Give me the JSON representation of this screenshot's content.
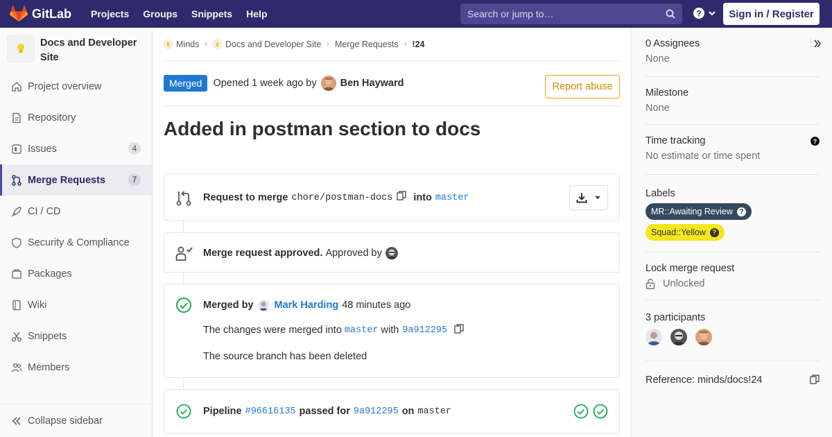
{
  "navbar": {
    "brand": "GitLab",
    "links": [
      "Projects",
      "Groups",
      "Snippets",
      "Help"
    ],
    "search_placeholder": "Search or jump to…",
    "signin_label": "Sign in / Register"
  },
  "sidebar": {
    "project_name": "Docs and Developer Site",
    "items": [
      {
        "label": "Project overview",
        "icon": "home-icon"
      },
      {
        "label": "Repository",
        "icon": "file-icon"
      },
      {
        "label": "Issues",
        "icon": "issues-icon",
        "count": "4"
      },
      {
        "label": "Merge Requests",
        "icon": "merge-request-icon",
        "count": "7",
        "active": true
      },
      {
        "label": "CI / CD",
        "icon": "rocket-icon"
      },
      {
        "label": "Security & Compliance",
        "icon": "shield-icon"
      },
      {
        "label": "Packages",
        "icon": "package-icon"
      },
      {
        "label": "Wiki",
        "icon": "book-icon"
      },
      {
        "label": "Snippets",
        "icon": "scissors-icon"
      },
      {
        "label": "Members",
        "icon": "users-icon"
      }
    ],
    "collapse_label": "Collapse sidebar"
  },
  "breadcrumbs": [
    "Minds",
    "Docs and Developer Site",
    "Merge Requests",
    "!24"
  ],
  "mr": {
    "status": "Merged",
    "opened_text": "Opened 1 week ago by",
    "author": "Ben Hayward",
    "report_label": "Report abuse",
    "title": "Added in postman section to docs"
  },
  "widgets": {
    "merge_request": {
      "prefix": "Request to merge",
      "source_branch": "chore/postman-docs",
      "into": "into",
      "target_branch": "master"
    },
    "approval": {
      "bold": "Merge request approved.",
      "text": "Approved by"
    },
    "merged": {
      "prefix": "Merged by",
      "user": "Mark Harding",
      "time": "48 minutes ago",
      "changes_prefix": "The changes were merged into",
      "branch": "master",
      "with": "with",
      "sha": "9a912295",
      "deleted_text": "The source branch has been deleted"
    },
    "pipeline": {
      "prefix": "Pipeline",
      "id": "#96616135",
      "passed": "passed for",
      "sha": "9a912295",
      "on": "on",
      "branch": "master"
    }
  },
  "right_sidebar": {
    "assignees_title": "0 Assignees",
    "assignees_value": "None",
    "milestone_title": "Milestone",
    "milestone_value": "None",
    "time_title": "Time tracking",
    "time_value": "No estimate or time spent",
    "labels_title": "Labels",
    "labels": [
      {
        "text": "MR::Awaiting Review",
        "color": "#34495e"
      },
      {
        "text": "Squad::Yellow",
        "color": "#f5e51e"
      }
    ],
    "lock_title": "Lock merge request",
    "lock_value": "Unlocked",
    "participants_title": "3 participants",
    "reference": "Reference: minds/docs!24"
  },
  "colors": {
    "navbar": "#2f2a6b",
    "link": "#1f78d1",
    "success": "#1aaa55",
    "report": "#e9a01a"
  }
}
